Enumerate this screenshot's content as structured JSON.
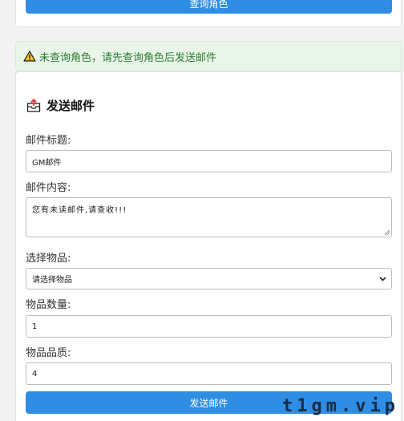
{
  "query_role_button": "查询角色",
  "alert": {
    "icon": "warning-icon",
    "text": "未查询角色，请先查询角色后发送邮件",
    "color": "#2e7d32"
  },
  "mail_form": {
    "title": "发送邮件",
    "title_icon": "outbox-icon",
    "subject_label": "邮件标题:",
    "subject_value": "GM邮件",
    "content_label": "邮件内容:",
    "content_value": "您有未读邮件,请查收!!!",
    "item_label": "选择物品:",
    "item_selected": "请选择物品",
    "quantity_label": "物品数量:",
    "quantity_value": "1",
    "quality_label": "物品品质:",
    "quality_value": "4",
    "send_button": "发送邮件"
  },
  "watermark": "t1gm.vip",
  "colors": {
    "primary": "#2f8de4",
    "alert_bg": "#e8f5e8"
  }
}
